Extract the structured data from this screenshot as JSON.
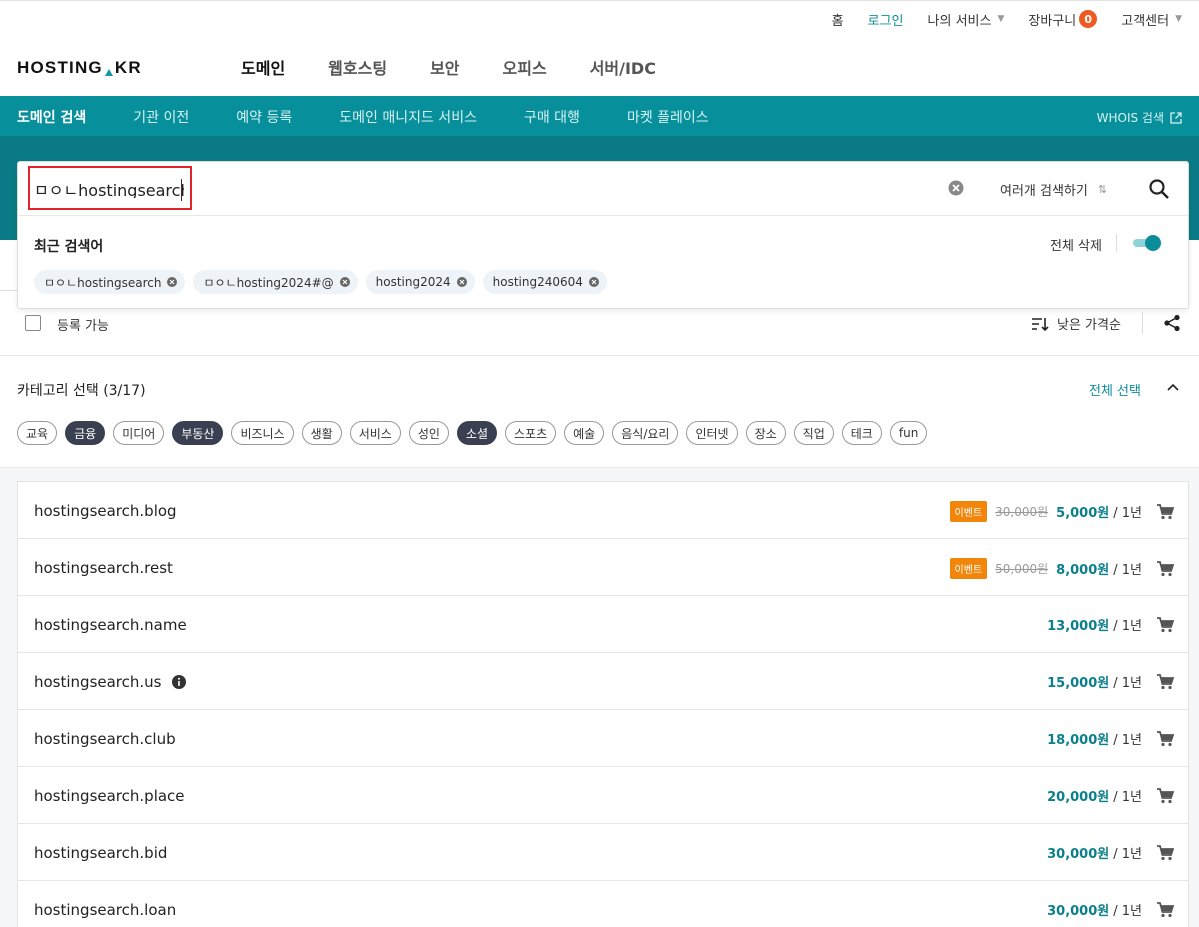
{
  "util_nav": {
    "home": "홈",
    "login": "로그인",
    "my_services": "나의 서비스",
    "cart": "장바구니",
    "cart_count": "0",
    "support": "고객센터"
  },
  "logo": {
    "left": "HOSTING",
    "right": "KR"
  },
  "gnb": [
    "도메인",
    "웹호스팅",
    "보안",
    "오피스",
    "서버/IDC"
  ],
  "subnav": {
    "items": [
      "도메인 검색",
      "기관 이전",
      "예약 등록",
      "도메인 매니지드 서비스",
      "구매 대행",
      "마켓 플레이스"
    ],
    "whois": "WHOIS 검색"
  },
  "search": {
    "value": "ㅁㅇㄴhostingsearch",
    "multi_search": "여러개 검색하기",
    "recent_title": "최근 검색어",
    "delete_all": "전체 삭제",
    "recent": [
      "ㅁㅇㄴhostingsearch",
      "ㅁㅇㄴhosting2024#@",
      "hosting2024",
      "hosting240604"
    ]
  },
  "filter": {
    "available_label": "등록 가능",
    "sort_label": "낮은 가격순"
  },
  "category": {
    "title": "카테고리 선택",
    "count": "(3/17)",
    "select_all": "전체 선택",
    "tags": [
      {
        "label": "교육",
        "on": false
      },
      {
        "label": "금융",
        "on": true
      },
      {
        "label": "미디어",
        "on": false
      },
      {
        "label": "부동산",
        "on": true
      },
      {
        "label": "비즈니스",
        "on": false
      },
      {
        "label": "생활",
        "on": false
      },
      {
        "label": "서비스",
        "on": false
      },
      {
        "label": "성인",
        "on": false
      },
      {
        "label": "소셜",
        "on": true
      },
      {
        "label": "스포츠",
        "on": false
      },
      {
        "label": "예술",
        "on": false
      },
      {
        "label": "음식/요리",
        "on": false
      },
      {
        "label": "인터넷",
        "on": false
      },
      {
        "label": "장소",
        "on": false
      },
      {
        "label": "직업",
        "on": false
      },
      {
        "label": "테크",
        "on": false
      },
      {
        "label": "fun",
        "on": false
      }
    ]
  },
  "results": [
    {
      "domain": "hostingsearch.blog",
      "event": "이벤트",
      "original": "30,000원",
      "price": "5,000원",
      "period": "/ 1년",
      "info": false
    },
    {
      "domain": "hostingsearch.rest",
      "event": "이벤트",
      "original": "50,000원",
      "price": "8,000원",
      "period": "/ 1년",
      "info": false
    },
    {
      "domain": "hostingsearch.name",
      "event": "",
      "original": "",
      "price": "13,000원",
      "period": "/ 1년",
      "info": false
    },
    {
      "domain": "hostingsearch.us",
      "event": "",
      "original": "",
      "price": "15,000원",
      "period": "/ 1년",
      "info": true
    },
    {
      "domain": "hostingsearch.club",
      "event": "",
      "original": "",
      "price": "18,000원",
      "period": "/ 1년",
      "info": false
    },
    {
      "domain": "hostingsearch.place",
      "event": "",
      "original": "",
      "price": "20,000원",
      "period": "/ 1년",
      "info": false
    },
    {
      "domain": "hostingsearch.bid",
      "event": "",
      "original": "",
      "price": "30,000원",
      "period": "/ 1년",
      "info": false
    },
    {
      "domain": "hostingsearch.loan",
      "event": "",
      "original": "",
      "price": "30,000원",
      "period": "/ 1년",
      "info": false
    }
  ],
  "colors": {
    "teal": "#07909b",
    "teal_dark": "#0a7b86",
    "accent": "#0b8d99",
    "event": "#f2860b",
    "highlight": "#e0242c"
  }
}
